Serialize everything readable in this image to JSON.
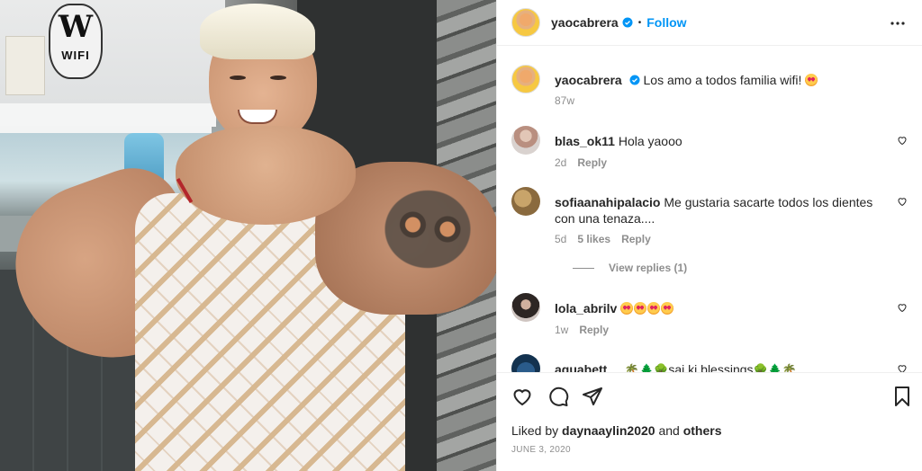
{
  "post": {
    "username": "yaocabrera",
    "follow_label": "Follow",
    "dot": "•"
  },
  "caption": {
    "username": "yaocabrera",
    "text": "Los amo a todos familia wifi!",
    "time": "87w"
  },
  "photo": {
    "sign_letter": "W",
    "sign_text": "WIFI"
  },
  "comments": [
    {
      "username": "blas_ok11",
      "text": "Hola yaooo",
      "time": "2d",
      "reply": "Reply"
    },
    {
      "username": "sofiaanahipalacio",
      "text": "Me gustaria sacarte todos los dientes con una tenaza....",
      "time": "5d",
      "likes": "5 likes",
      "reply": "Reply",
      "view_replies": "View replies (1)"
    },
    {
      "username": "lola_abrilv",
      "text": "",
      "time": "1w",
      "reply": "Reply"
    },
    {
      "username": "aquabett__",
      "text_mid": "sai ki blessings"
    }
  ],
  "footer": {
    "liked_by_prefix": "Liked by",
    "liked_by_user": "daynaaylin2020",
    "liked_by_and": "and",
    "liked_by_others": "others",
    "date": "JUNE 3, 2020"
  },
  "colors": {
    "accent": "#0095f6",
    "muted": "#8e8e8e",
    "text": "#262626"
  },
  "icons": [
    "verified-icon",
    "more-options-icon",
    "heart-icon",
    "comment-icon",
    "share-icon",
    "bookmark-icon"
  ]
}
